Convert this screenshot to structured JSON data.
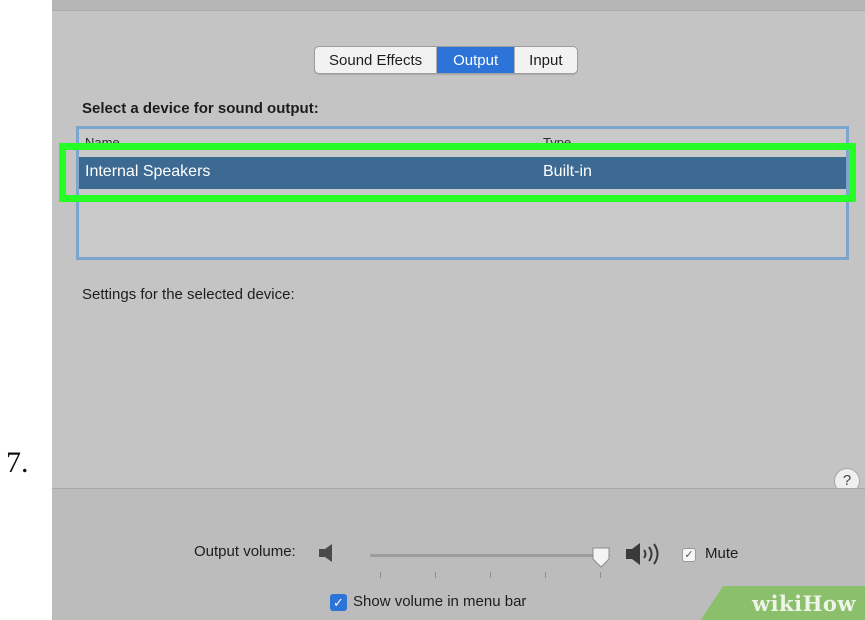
{
  "step": {
    "number": "7."
  },
  "tabs": [
    {
      "label": "Sound Effects",
      "active": false
    },
    {
      "label": "Output",
      "active": true
    },
    {
      "label": "Input",
      "active": false
    }
  ],
  "device_select": {
    "heading": "Select a device for sound output:",
    "columns": [
      "Name",
      "Type"
    ],
    "rows": [
      {
        "name": "Internal Speakers",
        "type": "Built-in",
        "selected": true
      }
    ]
  },
  "settings": {
    "label": "Settings for the selected device:"
  },
  "help": {
    "label": "?"
  },
  "volume": {
    "label": "Output volume:",
    "level": 0.95,
    "mute_label": "Mute",
    "mute_checked": false,
    "menu_bar_label": "Show volume in menu bar",
    "menu_bar_checked": true
  },
  "watermark": {
    "text": "wikiHow"
  },
  "colors": {
    "accent": "#2c74d8",
    "selected_row": "#3d6a92",
    "highlight": "#26ff26",
    "panel": "#c4c4c4"
  },
  "icons": [
    "speaker-low-icon",
    "speaker-high-icon",
    "help-icon",
    "checkmark-icon"
  ]
}
